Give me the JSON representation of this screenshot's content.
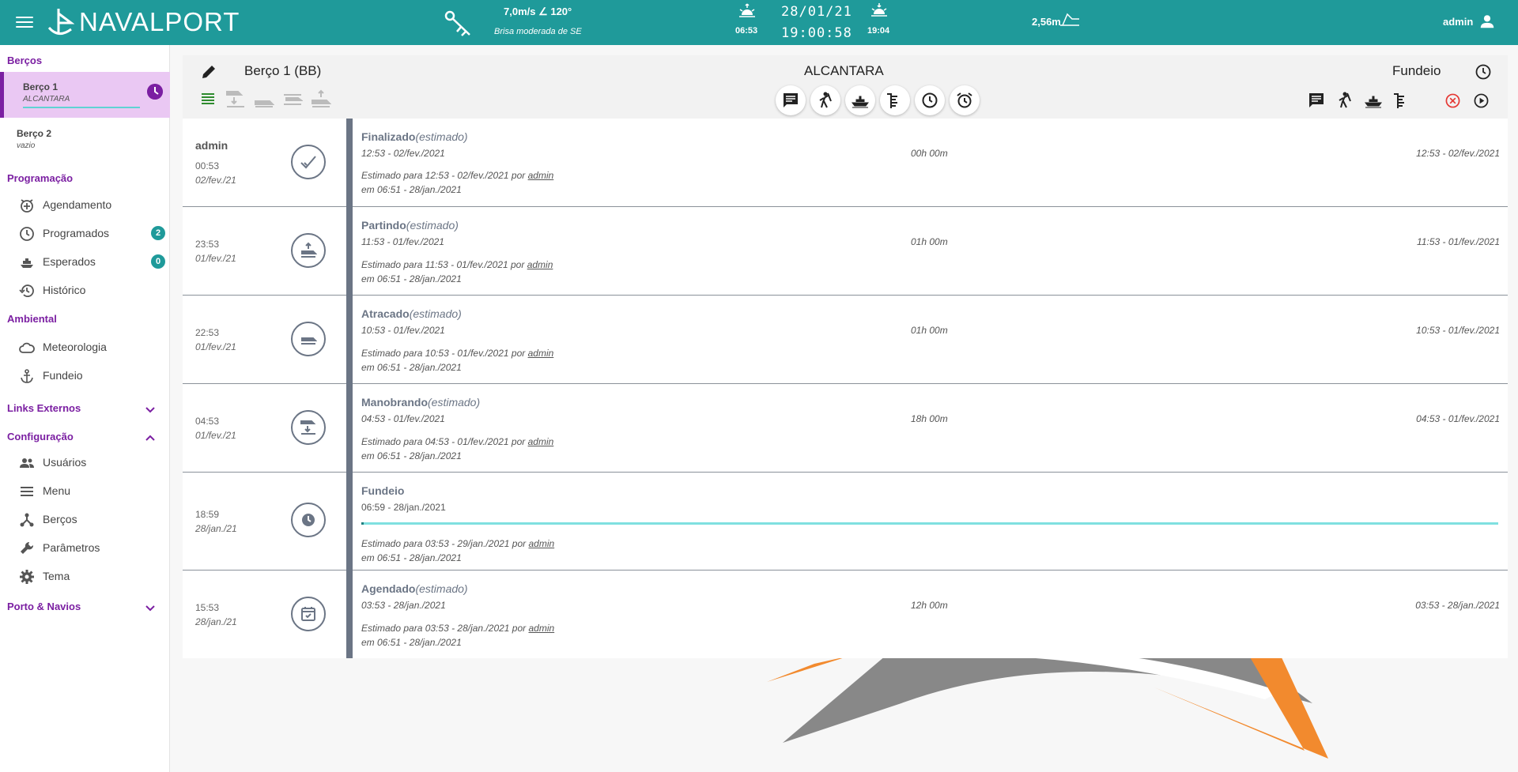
{
  "header": {
    "logo_text": "NAVALPORT",
    "wind_speed": "7,0m/s ∠ 120°",
    "wind_desc": "Brisa moderada de SE",
    "sunrise": "06:53",
    "date": "28/01/21",
    "time": "19:00:58",
    "sunset": "19:04",
    "tide": "2,56m",
    "user": "admin"
  },
  "sidebar": {
    "bercos_title": "Berços",
    "berths": [
      {
        "name": "Berço 1",
        "sub": "ALCANTARA"
      },
      {
        "name": "Berço 2",
        "sub": "vazio"
      }
    ],
    "programacao_title": "Programação",
    "programacao": [
      {
        "label": "Agendamento",
        "icon": "calendar-add-icon"
      },
      {
        "label": "Programados",
        "icon": "clock-icon",
        "badge": "2"
      },
      {
        "label": "Esperados",
        "icon": "ship-icon",
        "badge": "0"
      },
      {
        "label": "Histórico",
        "icon": "history-icon"
      }
    ],
    "ambiental_title": "Ambiental",
    "ambiental": [
      {
        "label": "Meteorologia",
        "icon": "cloud-icon"
      },
      {
        "label": "Fundeio",
        "icon": "anchor-icon"
      }
    ],
    "links_title": "Links Externos",
    "config_title": "Configuração",
    "config": [
      {
        "label": "Usuários",
        "icon": "users-icon"
      },
      {
        "label": "Menu",
        "icon": "menu-icon"
      },
      {
        "label": "Berços",
        "icon": "nodes-icon"
      },
      {
        "label": "Parâmetros",
        "icon": "wrench-icon"
      },
      {
        "label": "Tema",
        "icon": "gear-icon"
      }
    ],
    "porto_title": "Porto & Navios"
  },
  "panel": {
    "title": "Berço 1 (BB)",
    "place": "ALCANTARA",
    "status": "Fundeio"
  },
  "events": [
    {
      "user": "admin",
      "time": "00:53",
      "date": "02/fev./21",
      "icon": "check-icon",
      "title": "Finalizado",
      "title_suffix": "(estimado)",
      "range": "12:53 - 02/fev./2021",
      "duration": "00h 00m",
      "end": "12:53 - 02/fev./2021",
      "est": "Estimado para 12:53 - 02/fev./2021 por",
      "est_user": "admin",
      "on": "em 06:51 - 28/jan./2021"
    },
    {
      "user": "",
      "time": "23:53",
      "date": "01/fev./21",
      "icon": "undock-icon",
      "title": "Partindo",
      "title_suffix": "(estimado)",
      "range": "11:53 - 01/fev./2021",
      "duration": "01h 00m",
      "end": "11:53 - 01/fev./2021",
      "est": "Estimado para 11:53 - 01/fev./2021 por",
      "est_user": "admin",
      "on": "em 06:51 - 28/jan./2021"
    },
    {
      "user": "",
      "time": "22:53",
      "date": "01/fev./21",
      "icon": "docked-icon",
      "title": "Atracado",
      "title_suffix": "(estimado)",
      "range": "10:53 - 01/fev./2021",
      "duration": "01h 00m",
      "end": "10:53 - 01/fev./2021",
      "est": "Estimado para 10:53 - 01/fev./2021 por",
      "est_user": "admin",
      "on": "em 06:51 - 28/jan./2021"
    },
    {
      "user": "",
      "time": "04:53",
      "date": "01/fev./21",
      "icon": "maneuver-icon",
      "title": "Manobrando",
      "title_suffix": "(estimado)",
      "range": "04:53 - 01/fev./2021",
      "duration": "18h 00m",
      "end": "04:53 - 01/fev./2021",
      "est": "Estimado para 04:53 - 01/fev./2021 por",
      "est_user": "admin",
      "on": "em 06:51 - 28/jan./2021"
    },
    {
      "user": "",
      "time": "18:59",
      "date": "28/jan./21",
      "icon": "clock-icon",
      "title": "Fundeio",
      "title_suffix": "",
      "range": "06:59 - 28/jan./2021",
      "duration": "",
      "end": "",
      "progress": 0.002,
      "est": "Estimado para 03:53 - 29/jan./2021 por",
      "est_user": "admin",
      "on": "em 06:51 - 28/jan./2021"
    },
    {
      "user": "",
      "time": "15:53",
      "date": "28/jan./21",
      "icon": "calendar-check-icon",
      "title": "Agendado",
      "title_suffix": "(estimado)",
      "range": "03:53 - 28/jan./2021",
      "duration": "12h 00m",
      "end": "03:53 - 28/jan./2021",
      "est": "Estimado para 03:53 - 28/jan./2021 por",
      "est_user": "admin",
      "on": "em 06:51 - 28/jan./2021"
    }
  ]
}
